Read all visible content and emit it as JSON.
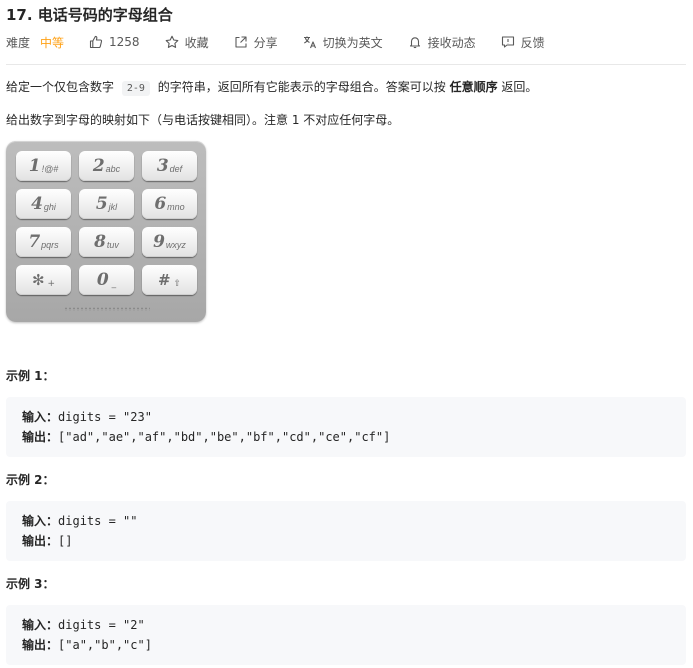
{
  "problem": {
    "title": "17. 电话号码的字母组合",
    "difficulty_label": "难度",
    "difficulty_value": "中等",
    "likes": "1258",
    "favorite_label": "收藏",
    "share_label": "分享",
    "translate_label": "切换为英文",
    "notify_label": "接收动态",
    "feedback_label": "反馈"
  },
  "description": {
    "p1_before": "给定一个仅包含数字",
    "p1_code": "2-9",
    "p1_middle": "的字符串，返回所有它能表示的字母组合。答案可以按",
    "p1_bold": "任意顺序",
    "p1_after": "返回。",
    "p2": "给出数字到字母的映射如下（与电话按键相同）。注意 1 不对应任何字母。"
  },
  "keypad": {
    "keys": [
      {
        "digit": "1",
        "letters": "!@#"
      },
      {
        "digit": "2",
        "letters": "abc"
      },
      {
        "digit": "3",
        "letters": "def"
      },
      {
        "digit": "4",
        "letters": "ghi"
      },
      {
        "digit": "5",
        "letters": "jkl"
      },
      {
        "digit": "6",
        "letters": "mno"
      },
      {
        "digit": "7",
        "letters": "pqrs"
      },
      {
        "digit": "8",
        "letters": "tuv"
      },
      {
        "digit": "9",
        "letters": "wxyz"
      },
      {
        "digit": "✻",
        "letters": "+"
      },
      {
        "digit": "0",
        "letters": "_"
      },
      {
        "digit": "#",
        "letters": "⇧"
      }
    ]
  },
  "examples": [
    {
      "title": "示例 1：",
      "input_label": "输入：",
      "input": "digits = \"23\"",
      "output_label": "输出：",
      "output": "[\"ad\",\"ae\",\"af\",\"bd\",\"be\",\"bf\",\"cd\",\"ce\",\"cf\"]"
    },
    {
      "title": "示例 2：",
      "input_label": "输入：",
      "input": "digits = \"\"",
      "output_label": "输出：",
      "output": "[]"
    },
    {
      "title": "示例 3：",
      "input_label": "输入：",
      "input": "digits = \"2\"",
      "output_label": "输出：",
      "output": "[\"a\",\"b\",\"c\"]"
    }
  ],
  "colors": {
    "accent_difficulty": "#ffa116",
    "code_block_bg": "#f7f8fa",
    "text": "#262626"
  }
}
